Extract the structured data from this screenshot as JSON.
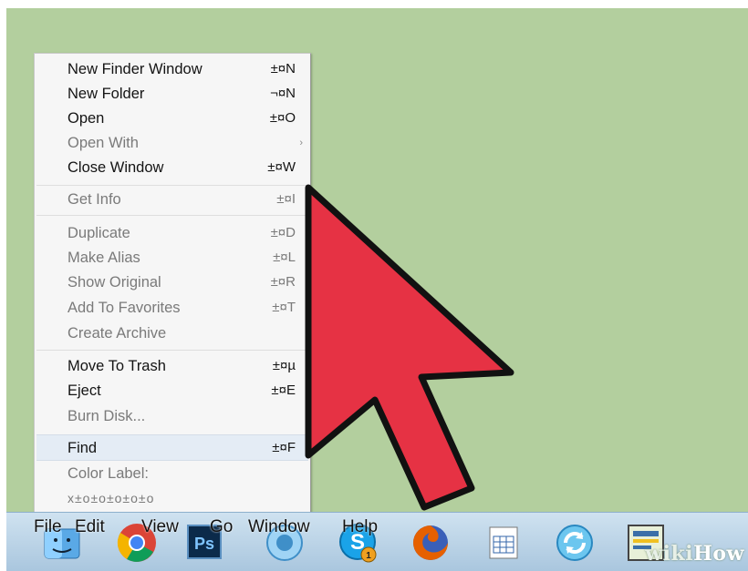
{
  "menu": {
    "items": [
      {
        "label": "New Finder Window",
        "shortcut": "±¤N",
        "enabled": true
      },
      {
        "label": "New Folder",
        "shortcut": "¬¤N",
        "enabled": true
      },
      {
        "label": "Open",
        "shortcut": "±¤O",
        "enabled": true
      },
      {
        "label": "Open With",
        "shortcut": "›",
        "enabled": false
      },
      {
        "label": "Close Window",
        "shortcut": "±¤W",
        "enabled": true
      },
      {
        "label": "Get Info",
        "shortcut": "±¤I",
        "enabled": false
      },
      {
        "label": "Duplicate",
        "shortcut": "±¤D",
        "enabled": false
      },
      {
        "label": "Make Alias",
        "shortcut": "±¤L",
        "enabled": false
      },
      {
        "label": "Show Original",
        "shortcut": "±¤R",
        "enabled": false
      },
      {
        "label": "Add To Favorites",
        "shortcut": "±¤T",
        "enabled": false
      },
      {
        "label": "Create Archive",
        "shortcut": "",
        "enabled": false
      },
      {
        "label": "Move To Trash",
        "shortcut": "±¤µ",
        "enabled": true
      },
      {
        "label": "Eject",
        "shortcut": "±¤E",
        "enabled": true
      },
      {
        "label": "Burn Disk...",
        "shortcut": "",
        "enabled": false
      },
      {
        "label": "Find",
        "shortcut": "±¤F",
        "enabled": true,
        "highlighted": true
      },
      {
        "label": "Color Label:",
        "shortcut": "",
        "enabled": false
      },
      {
        "label": "x±o±o±o±o±o",
        "shortcut": "",
        "enabled": false
      }
    ]
  },
  "menubar": {
    "file": "File",
    "edit": "Edit",
    "view": "View",
    "go": "Go",
    "window": "Window",
    "help": "Help"
  },
  "taskbar": {
    "icons": [
      "finder-icon",
      "chrome-icon",
      "photoshop-icon",
      "itunes-icon",
      "skype-icon",
      "firefox-icon",
      "calendar-icon",
      "sync-icon",
      "notes-icon"
    ],
    "ps_text": "Ps",
    "badge": "1"
  },
  "watermark": {
    "wiki": "wiki",
    "how": "How"
  },
  "colors": {
    "desktop": "#b3cf9e",
    "arrow": "#e63244",
    "menu_bg": "#f6f6f6",
    "highlight": "#e4ecf5"
  }
}
